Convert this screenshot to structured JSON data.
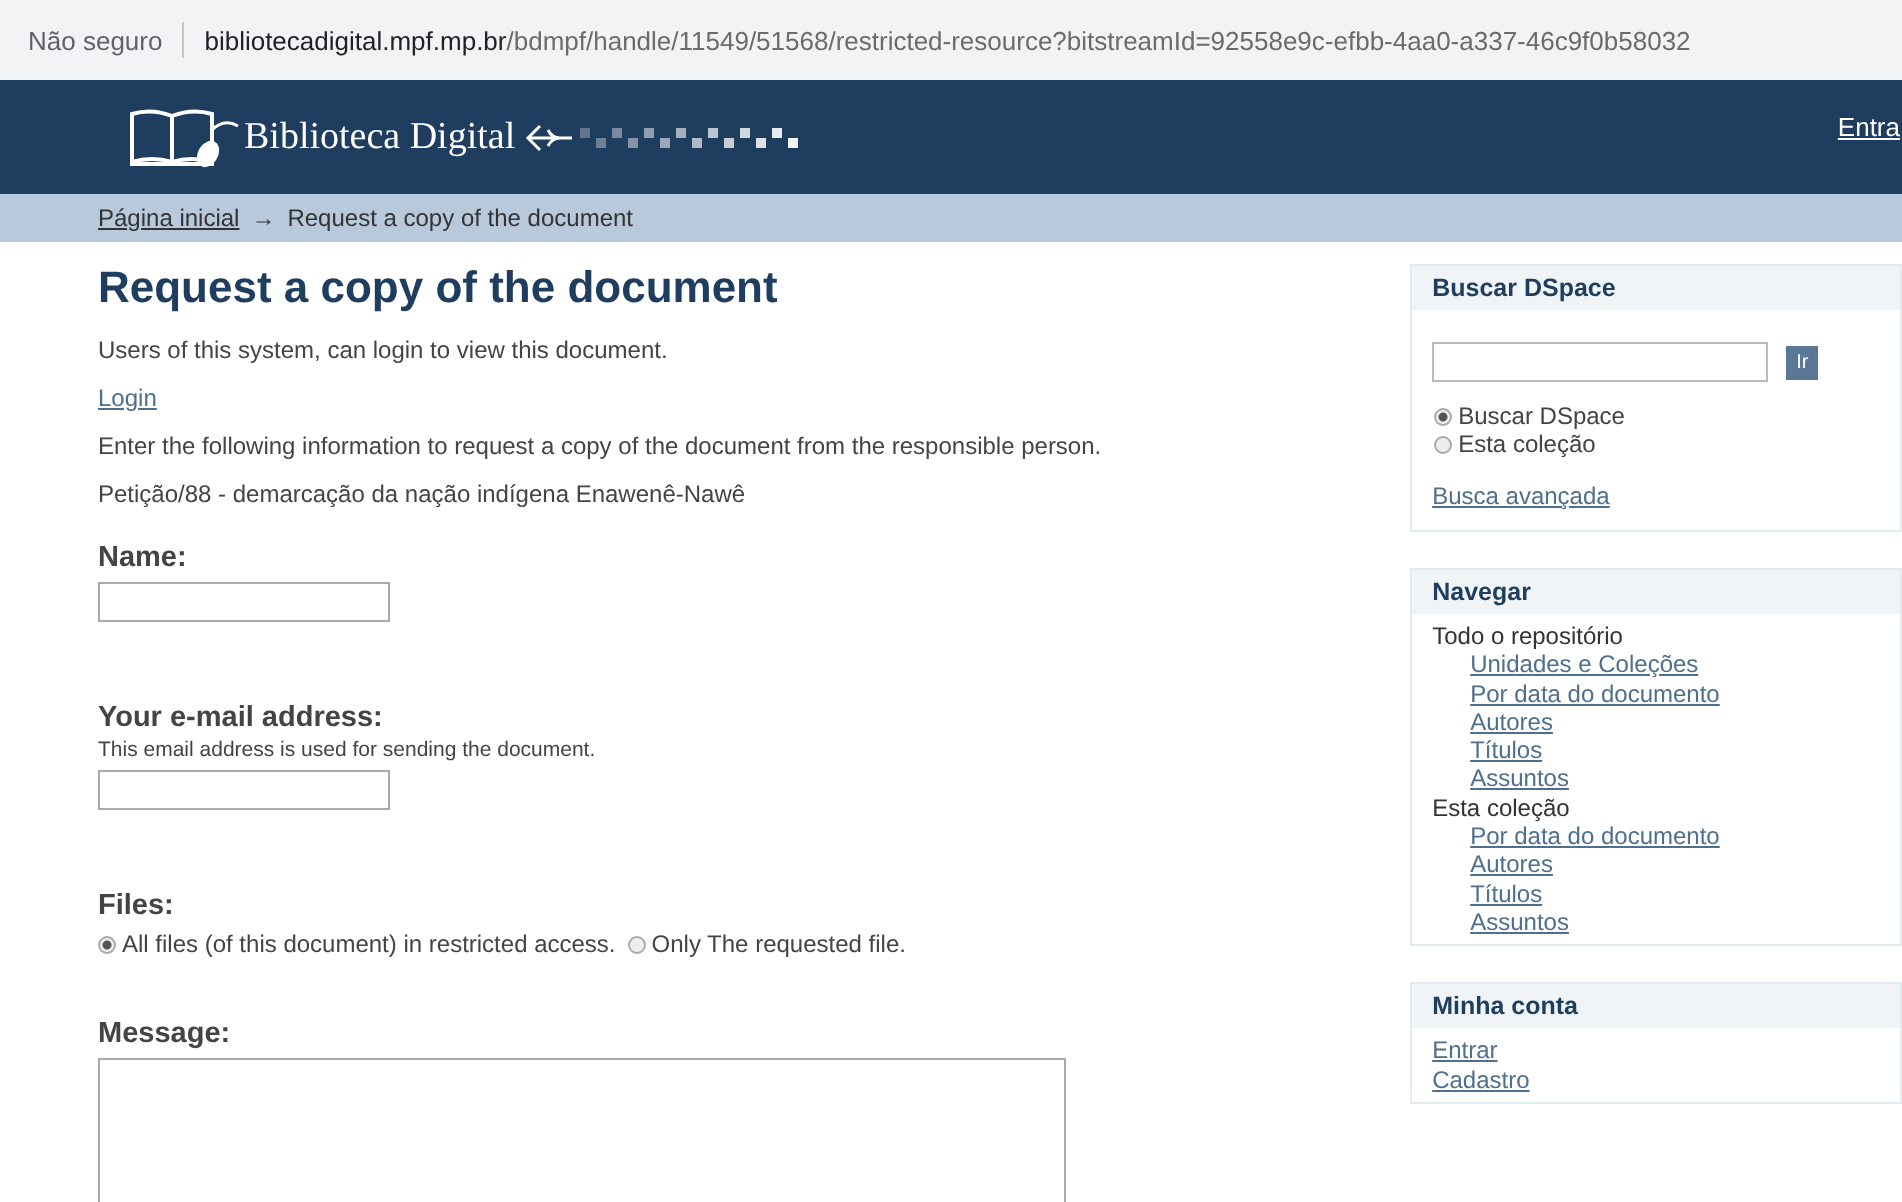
{
  "browser": {
    "security": "Não seguro",
    "url": {
      "host": "bibliotecadigital.mpf.mp.br",
      "path": "/bdmpf/handle/11549/51568/restricted-resource?bitstreamId=92558e9c-efbb-4aa0-a337-46c9f0b58032"
    }
  },
  "header": {
    "logo_text": "Biblioteca Digital",
    "login_link": "Entra"
  },
  "breadcrumb": {
    "home": "Página inicial",
    "separator": "→",
    "current": "Request a copy of the document"
  },
  "main": {
    "title": "Request a copy of the document",
    "intro": "Users of this system, can login to view this document.",
    "login_link": "Login",
    "instructions": "Enter the following information to request a copy of the document from the responsible person.",
    "document": "Petição/88 - demarcação da nação indígena Enawenê-Nawê",
    "name_label": "Name:",
    "email_label": "Your e-mail address:",
    "email_help": "This email address is used for sending the document.",
    "files_label": "Files:",
    "files_options": [
      {
        "label": "All files (of this document) in restricted access.",
        "selected": true
      },
      {
        "label": "Only The requested file.",
        "selected": false
      }
    ],
    "message_label": "Message:"
  },
  "sidebar": {
    "search": {
      "title": "Buscar DSpace",
      "button": "Ir",
      "scopes": [
        {
          "label": "Buscar DSpace",
          "selected": true
        },
        {
          "label": "Esta coleção",
          "selected": false
        }
      ],
      "advanced": "Busca avançada"
    },
    "browse": {
      "title": "Navegar",
      "groups": [
        {
          "label": "Todo o repositório",
          "links": [
            "Unidades e Coleções",
            "Por data do documento",
            "Autores",
            "Títulos",
            "Assuntos"
          ]
        },
        {
          "label": "Esta coleção",
          "links": [
            "Por data do documento",
            "Autores",
            "Títulos",
            "Assuntos"
          ]
        }
      ]
    },
    "account": {
      "title": "Minha conta",
      "links": [
        "Entrar",
        "Cadastro"
      ]
    }
  }
}
